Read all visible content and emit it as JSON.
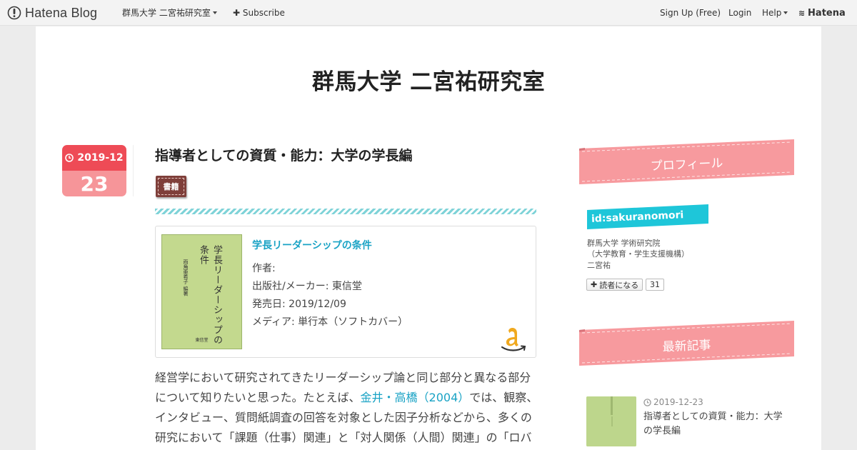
{
  "topbar": {
    "logo_text": "Hatena Blog",
    "blog_menu": "群馬大学 二宮祐研究室",
    "subscribe": "Subscribe",
    "signup": "Sign Up (Free)",
    "login": "Login",
    "help": "Help",
    "hatena": "Hatena"
  },
  "blog": {
    "title": "群馬大学 二宮祐研究室"
  },
  "entry": {
    "date_month": "2019-12",
    "date_day": "23",
    "title": "指導者としての資質・能力：大学の学長編",
    "category": "書籍"
  },
  "book": {
    "title_link": "学長リーダーシップの条件",
    "cover_title": "学長リーダーシップの条件",
    "cover_author": "両角亜希子 編著",
    "cover_publisher": "東信堂",
    "author": "作者:",
    "publisher": "出版社/メーカー: 東信堂",
    "release": "発売日: 2019/12/09",
    "media": "メディア: 単行本（ソフトカバー）"
  },
  "body": {
    "line1": "経営学において研究されてきたリーダーシップ論と同じ部分と異なる部分",
    "line2_pre": "について知りたいと思った。たとえば、",
    "line2_link": "金井・高橋（2004）",
    "line2_post": "では、観察、",
    "line3": "インタビュー、質問紙調査の回答を対象とした因子分析などから、多くの",
    "line4": "研究において「課題（仕事）関連」と「対人関係（人間）関連」の「ロバ"
  },
  "sidebar": {
    "profile_heading": "プロフィール",
    "profile_id": "id:sakuranomori",
    "profile_line1": "群馬大学 学術研究院",
    "profile_line2": "（大学教育・学生支援機構）",
    "profile_line3": "二宮祐",
    "subscribe_label": "読者になる",
    "subscribe_count": "31",
    "recent_heading": "最新記事",
    "recent_date": "2019-12-23",
    "recent_title": "指導者としての資質・能力：大学の学長編"
  },
  "colors": {
    "date_top": "#ee4b56",
    "date_bottom": "#f69599",
    "ribbon": "#f79a9e",
    "link": "#1aa3c5",
    "profile_tag": "#1ec6d9",
    "category_tag": "#7f3f3a"
  }
}
